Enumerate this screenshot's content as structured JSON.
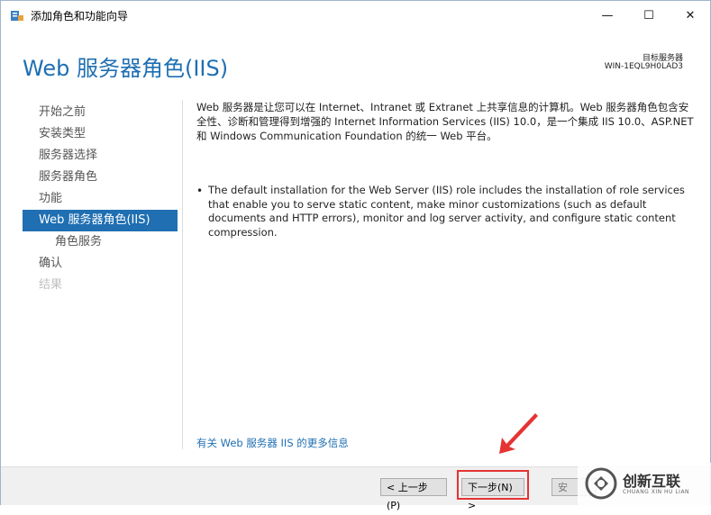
{
  "window": {
    "title": "添加角色和功能向导",
    "minimize": "—",
    "maximize": "☐",
    "close": "✕"
  },
  "header": {
    "title": "Web 服务器角色(IIS)",
    "target_label": "目标服务器",
    "target_value": "WIN-1EQL9H0LAD3"
  },
  "nav": {
    "items": [
      {
        "label": "开始之前"
      },
      {
        "label": "安装类型"
      },
      {
        "label": "服务器选择"
      },
      {
        "label": "服务器角色"
      },
      {
        "label": "功能"
      },
      {
        "label": "Web 服务器角色(IIS)"
      },
      {
        "label": "角色服务"
      },
      {
        "label": "确认"
      },
      {
        "label": "结果"
      }
    ]
  },
  "content": {
    "description": "Web 服务器是让您可以在 Internet、Intranet 或 Extranet 上共享信息的计算机。Web 服务器角色包含安全性、诊断和管理得到增强的 Internet Information Services (IIS) 10.0，是一个集成 IIS 10.0、ASP.NET 和 Windows Communication Foundation 的统一 Web 平台。",
    "bullet": "•",
    "note": "The default installation for the Web Server (IIS) role includes the installation of role services that enable you to serve static content, make minor customizations (such as default documents and HTTP errors), monitor and log server activity, and configure static content compression.",
    "more_info_link": "有关 Web 服务器 IIS 的更多信息"
  },
  "footer": {
    "prev": "< 上一步(P)",
    "next": "下一步(N) >",
    "install": "安"
  },
  "watermark": {
    "text": "创新互联",
    "sub": "CHUANG XIN HU LIAN"
  },
  "colors": {
    "accent": "#1f6fb2",
    "highlight": "#e53333"
  }
}
